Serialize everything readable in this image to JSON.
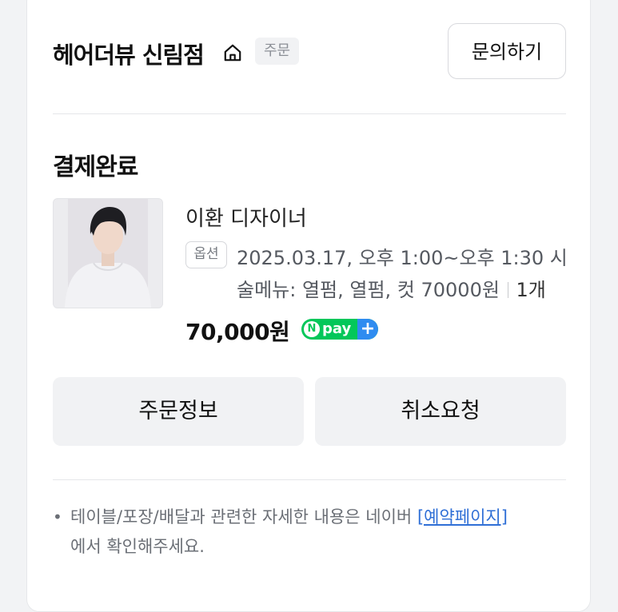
{
  "header": {
    "store_name": "헤어더뷰 신림점",
    "badge": "주문",
    "inquiry_button": "문의하기"
  },
  "order": {
    "status_title": "결제완료",
    "designer": "이환 디자이너",
    "option_badge": "옵션",
    "option_line1": "2025.03.17, 오후 1:00~오후 1:30 시",
    "option_line2": "술메뉴: 열펌, 열펌, 컷 70000원",
    "quantity": "1개",
    "price": "70,000원",
    "npay": {
      "n_letter": "N",
      "label": "pay",
      "plus": "+"
    }
  },
  "actions": {
    "order_info": "주문정보",
    "cancel_request": "취소요청"
  },
  "notice": {
    "bullet": "•",
    "text_before": "테이블/포장/배달과 관련한 자세한 내용은 네이버 ",
    "link": "[예약페이지]",
    "text_after": "에서 확인해주세요."
  },
  "colors": {
    "npay_green": "#03c75a",
    "npay_blue": "#2f8cf0",
    "link_blue": "#2f6fd6"
  },
  "icons": {
    "home": "home-icon"
  }
}
